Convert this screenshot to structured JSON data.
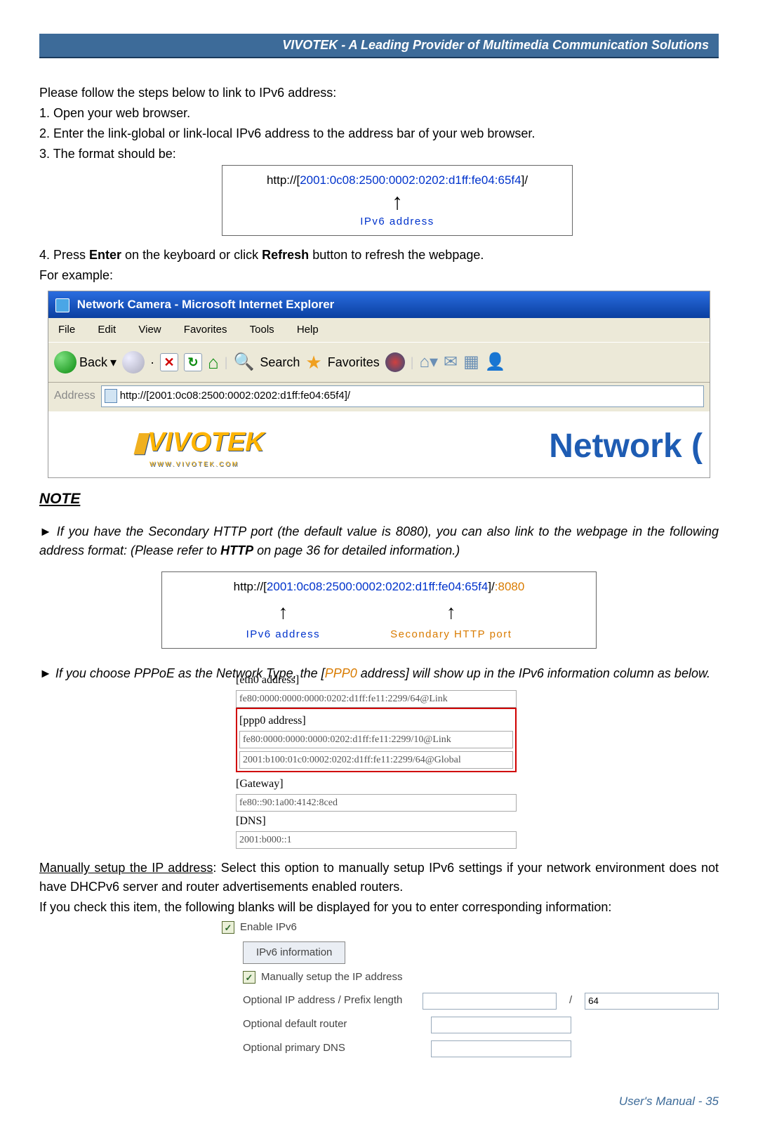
{
  "header": {
    "title": "VIVOTEK - A Leading Provider of Multimedia Communication Solutions"
  },
  "intro": {
    "line1": "Please follow the steps below to link to IPv6 address:",
    "step1": "1. Open your web browser.",
    "step2": "2. Enter the link-global or link-local IPv6 address to the address bar of your web browser.",
    "step3": "3. The format should be:"
  },
  "format1": {
    "prefix": "http://[",
    "addr": "2001:0c08:2500:0002:0202:d1ff:fe04:65f4",
    "suffix": "]/",
    "label": "IPv6 address"
  },
  "step4": {
    "line1_a": "4. Press ",
    "line1_b": "Enter",
    "line1_c": " on the keyboard or click ",
    "line1_d": "Refresh",
    "line1_e": " button to refresh the webpage.",
    "line2": "For example:"
  },
  "ie": {
    "title": "Network Camera - Microsoft Internet Explorer",
    "menu": {
      "file": "File",
      "edit": "Edit",
      "view": "View",
      "favorites": "Favorites",
      "tools": "Tools",
      "help": "Help"
    },
    "toolbar": {
      "back": "Back",
      "search": "Search",
      "favorites": "Favorites"
    },
    "address_label": "Address",
    "address_value": "http://[2001:0c08:2500:0002:0202:d1ff:fe04:65f4]/",
    "logo": "VIVOTEK",
    "logo_sub": "WWW.VIVOTEK.COM",
    "body_right": "Network"
  },
  "note": {
    "heading": "NOTE",
    "item1_a": "► If you have the Secondary HTTP port (the default value is 8080), you can also link to the webpage in the following address format: (Please refer to ",
    "item1_b": "HTTP",
    "item1_c": " on page 36 for detailed information.)"
  },
  "format2": {
    "prefix": "http://[",
    "addr": "2001:0c08:2500:0002:0202:d1ff:fe04:65f4",
    "mid": "]/",
    "port": ":8080",
    "label1": "IPv6 address",
    "label2": "Secondary HTTP port"
  },
  "note2": {
    "a": "► If you choose PPPoE as the Network Type, the [",
    "b": "PPP0",
    "c": " address] will show up in the IPv6 information column as below."
  },
  "ipv6info": {
    "eth0_label": "[eth0 address]",
    "eth0_val": "fe80:0000:0000:0000:0202:d1ff:fe11:2299/64@Link",
    "ppp0_label": "[ppp0 address]",
    "ppp0_val1": "fe80:0000:0000:0000:0202:d1ff:fe11:2299/10@Link",
    "ppp0_val2": "2001:b100:01c0:0002:0202:d1ff:fe11:2299/64@Global",
    "gateway_label": "[Gateway]",
    "gateway_val": "fe80::90:1a00:4142:8ced",
    "dns_label": "[DNS]",
    "dns_val": "2001:b000::1"
  },
  "manual": {
    "a": "Manually setup the IP address",
    "b": ": Select this option to manually setup IPv6 settings if your network environment does not have DHCPv6 server and router advertisements enabled routers.",
    "c": "If you check this item, the following blanks will be displayed for you to enter corresponding information:"
  },
  "form": {
    "enable": "Enable IPv6",
    "info_btn": "IPv6 information",
    "manual_cb": "Manually setup the IP address",
    "opt_ip": "Optional IP address / Prefix length",
    "prefix_val": "64",
    "opt_router": "Optional default router",
    "opt_dns": "Optional primary DNS"
  },
  "footer": {
    "text": "User's Manual - 35"
  }
}
